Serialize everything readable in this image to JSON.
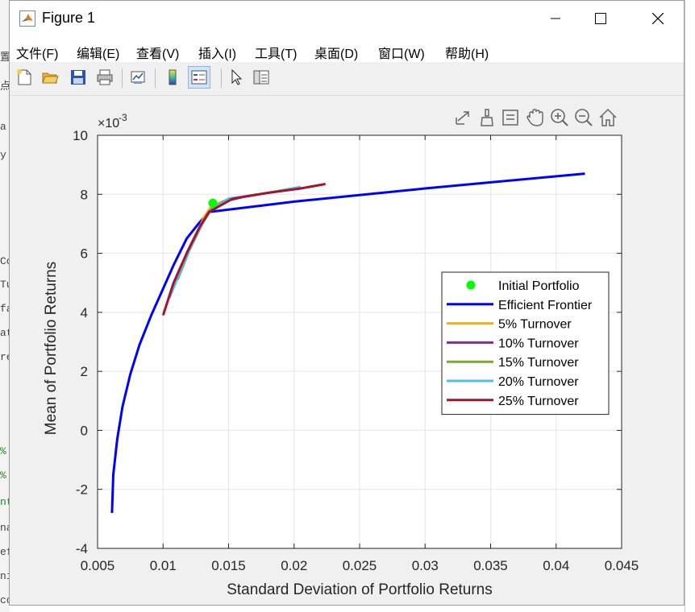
{
  "window": {
    "title": "Figure 1",
    "controls": {
      "minimize": "—",
      "maximize": "☐",
      "close": "✕"
    }
  },
  "menu": [
    "文件(F)",
    "编辑(E)",
    "查看(V)",
    "插入(I)",
    "工具(T)",
    "桌面(D)",
    "窗口(W)",
    "帮助(H)"
  ],
  "toolbar": {
    "buttons": [
      "new-figure-icon",
      "open-file-icon",
      "save-icon",
      "print-icon",
      "link-plot-icon",
      "colorbar-icon",
      "legend-icon",
      "pointer-icon",
      "property-inspector-icon"
    ]
  },
  "axes_toolbar": [
    "export-icon",
    "brush-icon",
    "data-tips-icon",
    "pan-hand-icon",
    "zoom-in-icon",
    "zoom-out-icon",
    "home-icon"
  ],
  "background_text": [
    "置",
    "点",
    "a",
    "y",
    "Co",
    "Tu",
    "fa",
    "at",
    "re",
    "%",
    "%",
    "nt",
    "na",
    "ef",
    "ni",
    "cc"
  ],
  "chart_data": {
    "type": "line",
    "xlabel": "Standard Deviation of Portfolio Returns",
    "ylabel": "Mean of Portfolio Returns",
    "y_exponent_label": "×10",
    "y_exponent": "-3",
    "xlim": [
      0.005,
      0.045
    ],
    "ylim": [
      -4,
      10
    ],
    "x_ticks": [
      "0.005",
      "0.01",
      "0.015",
      "0.02",
      "0.025",
      "0.03",
      "0.035",
      "0.04",
      "0.045"
    ],
    "y_ticks": [
      "-4",
      "-2",
      "0",
      "2",
      "4",
      "6",
      "8",
      "10"
    ],
    "grid": true,
    "legend_position": "center-right",
    "series": [
      {
        "name": "Initial Portfolio",
        "type": "marker",
        "color": "#00ff00",
        "x": [
          0.0138
        ],
        "y": [
          7.7
        ]
      },
      {
        "name": "Efficient Frontier",
        "type": "line",
        "color": "#0000ff",
        "x": [
          0.0061,
          0.0062,
          0.0065,
          0.0069,
          0.0075,
          0.0082,
          0.0091,
          0.01,
          0.0108,
          0.0118,
          0.0127,
          0.0135,
          0.02,
          0.03,
          0.0422
        ],
        "y": [
          -2.8,
          -1.5,
          -0.3,
          0.8,
          1.9,
          2.9,
          3.9,
          4.8,
          5.6,
          6.5,
          7.0,
          7.4,
          7.75,
          8.2,
          8.7
        ]
      },
      {
        "name": "5% Turnover",
        "type": "line",
        "color": "#edb120",
        "x": [
          0.0127,
          0.0131,
          0.0137,
          0.0148
        ],
        "y": [
          6.8,
          7.2,
          7.6,
          7.8
        ]
      },
      {
        "name": "10% Turnover",
        "type": "line",
        "color": "#7e2f8e",
        "x": [
          0.0118,
          0.0127,
          0.0135,
          0.0146,
          0.016
        ],
        "y": [
          6.0,
          6.8,
          7.4,
          7.75,
          7.9
        ]
      },
      {
        "name": "15% Turnover",
        "type": "line",
        "color": "#77ac30",
        "x": [
          0.0111,
          0.012,
          0.013,
          0.0137,
          0.015,
          0.0172
        ],
        "y": [
          5.1,
          6.1,
          7.0,
          7.5,
          7.85,
          8.0
        ]
      },
      {
        "name": "20% Turnover",
        "type": "line",
        "color": "#4dbeee",
        "x": [
          0.0105,
          0.0115,
          0.0125,
          0.0135,
          0.015,
          0.018,
          0.0205
        ],
        "y": [
          4.5,
          5.6,
          6.6,
          7.4,
          7.85,
          8.05,
          8.25
        ]
      },
      {
        "name": "25% Turnover",
        "type": "line",
        "color": "#a2142f",
        "x": [
          0.01,
          0.0108,
          0.0118,
          0.0128,
          0.0135,
          0.0153,
          0.018,
          0.0205,
          0.0224
        ],
        "y": [
          3.9,
          5.0,
          6.0,
          6.9,
          7.4,
          7.85,
          8.05,
          8.2,
          8.35
        ]
      }
    ]
  }
}
